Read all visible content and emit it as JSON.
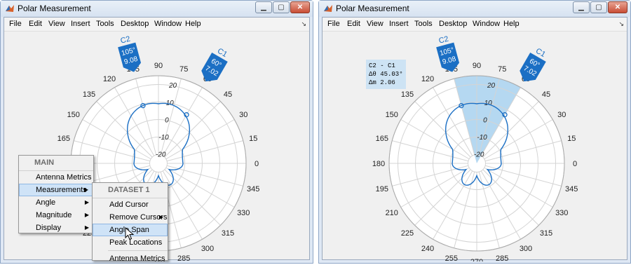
{
  "title": "Polar Measurement",
  "window_buttons": {
    "minimize": "▁",
    "maximize": "▢",
    "close": "✕"
  },
  "dock_symbol": "↘",
  "menu": [
    "File",
    "Edit",
    "View",
    "Insert",
    "Tools",
    "Desktop",
    "Window",
    "Help"
  ],
  "plot": {
    "angle_labels": [
      "0",
      "15",
      "30",
      "45",
      "60",
      "75",
      "90",
      "105",
      "120",
      "135",
      "150",
      "165",
      "180",
      "195",
      "210",
      "225",
      "240",
      "255",
      "270",
      "285",
      "300",
      "315",
      "330",
      "345"
    ],
    "magnitude_labels": [
      "20",
      "10",
      "0",
      "-10",
      "-20"
    ],
    "magnitude_range": [
      -25,
      25
    ],
    "trace_color": "#1b6fc4",
    "span_color": "#9ccbec"
  },
  "cursors": {
    "c2": {
      "name": "C2",
      "angle": "105°",
      "value": "9.08",
      "angle_deg": 105,
      "magnitude": 9.08
    },
    "c1": {
      "name": "C1",
      "angle": "60°",
      "value": "7.02",
      "angle_deg": 60,
      "magnitude": 7.02
    }
  },
  "span_annotation": {
    "line1": "C2 - C1",
    "line2": "Δθ 45.03°",
    "line3": "Δm 2.06"
  },
  "context_menu": {
    "main_header": "MAIN",
    "main_items": [
      "Antenna Metrics",
      "Measurements",
      "Angle",
      "Magnitude",
      "Display"
    ],
    "sub_header": "DATASET 1",
    "sub_items": [
      "Add Cursor",
      "Remove Cursors",
      "Angle Span",
      "Peak Locations",
      "Antenna Metrics"
    ]
  },
  "colors": {
    "accent": "#1b6fc4",
    "menu_highlight": "#cfe3f7"
  }
}
